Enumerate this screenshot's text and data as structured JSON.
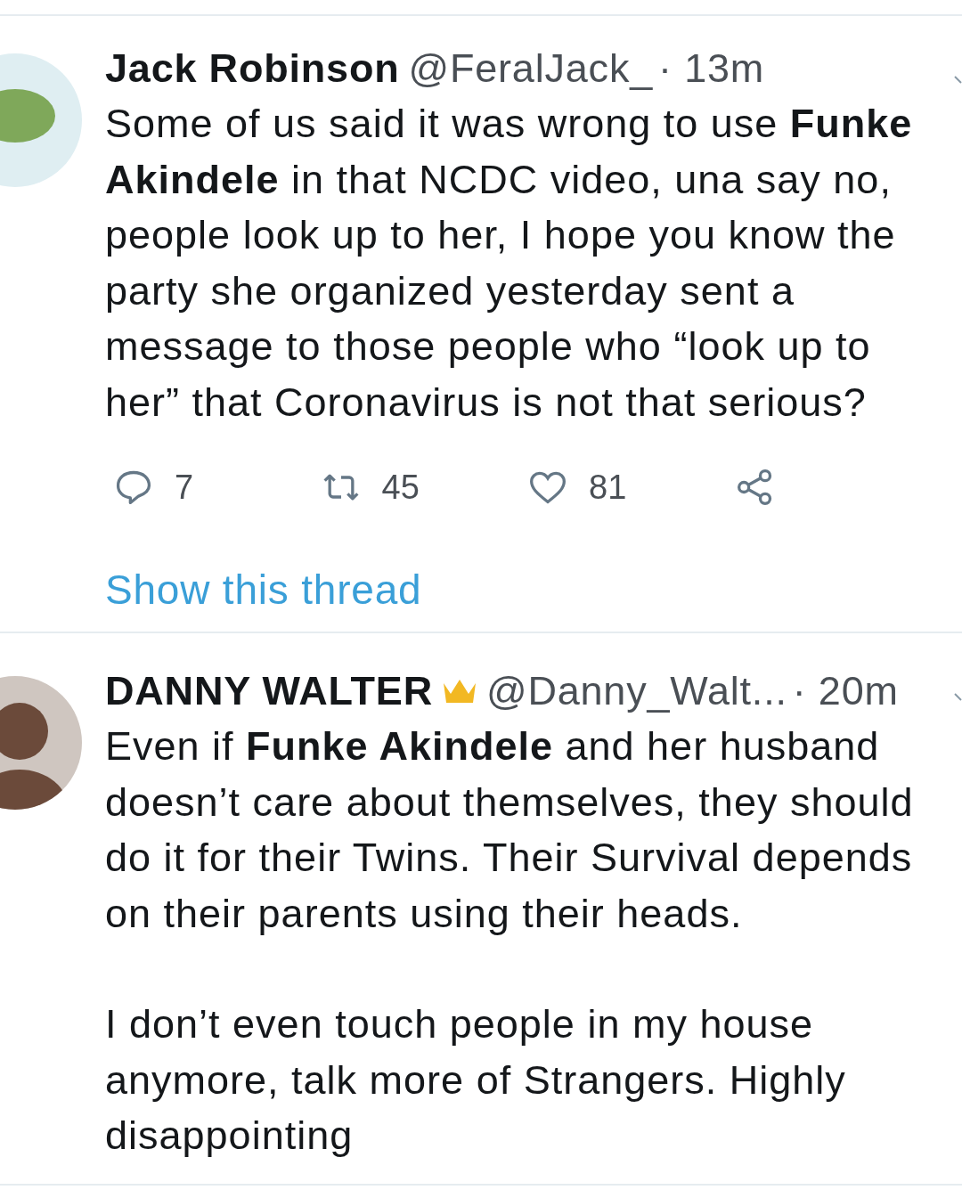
{
  "tweets": [
    {
      "name": "Jack Robinson",
      "badge": false,
      "handle": "@FeralJack_",
      "time": "· 13m",
      "kind": "plain",
      "paragraphs": [
        "Some of us said it was wrong to use **Funke Akindele** in that NCDC video, una say no, people look up to her, I hope you know the party she organized yesterday sent a message to those people who “look up to her” that Coronavirus is not that serious?"
      ],
      "actions": [
        {
          "kind": "reply",
          "count": "7"
        },
        {
          "kind": "retweet",
          "count": "45"
        },
        {
          "kind": "like",
          "count": "81"
        },
        {
          "kind": "share"
        }
      ],
      "thread_link": "Show this thread"
    },
    {
      "name": "DANNY WALTER",
      "badge": true,
      "handle": "@Danny_Walt...",
      "time": "· 20m",
      "kind": "person",
      "paragraphs": [
        "Even if **Funke Akindele** and her husband doesn’t care about themselves, they should do it for their Twins. Their Survival depends on their parents using their heads.",
        "I don’t even touch people in my house anymore, talk more of Strangers. Highly disappointing"
      ]
    }
  ]
}
